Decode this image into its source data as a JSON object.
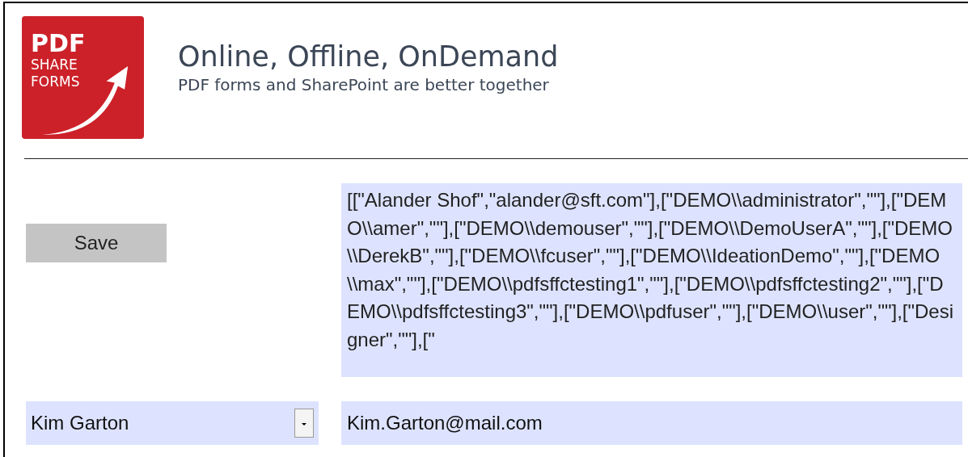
{
  "logo": {
    "lines": [
      "PDF",
      "SHARE",
      "FORMS"
    ]
  },
  "header": {
    "title": "Online, Offline, OnDemand",
    "subtitle": "PDF forms and SharePoint are better together"
  },
  "save_button": {
    "label": "Save"
  },
  "users_field": {
    "value": "[[\"Alander Shof\",\"alander@sft.com\"],[\"DEMO\\\\administrator\",\"\"],[\"DEMO\\\\amer\",\"\"],[\"DEMO\\\\demouser\",\"\"],[\"DEMO\\\\DemoUserA\",\"\"],[\"DEMO\\\\DerekB\",\"\"],[\"DEMO\\\\fcuser\",\"\"],[\"DEMO\\\\IdeationDemo\",\"\"],[\"DEMO\\\\max\",\"\"],[\"DEMO\\\\pdfsffctesting1\",\"\"],[\"DEMO\\\\pdfsffctesting2\",\"\"],[\"DEMO\\\\pdfsffctesting3\",\"\"],[\"DEMO\\\\pdfuser\",\"\"],[\"DEMO\\\\user\",\"\"],[\"Designer\",\"\"],[\""
  },
  "user_dropdown": {
    "value": "Kim Garton"
  },
  "email_field": {
    "value": "Kim.Garton@mail.com"
  }
}
